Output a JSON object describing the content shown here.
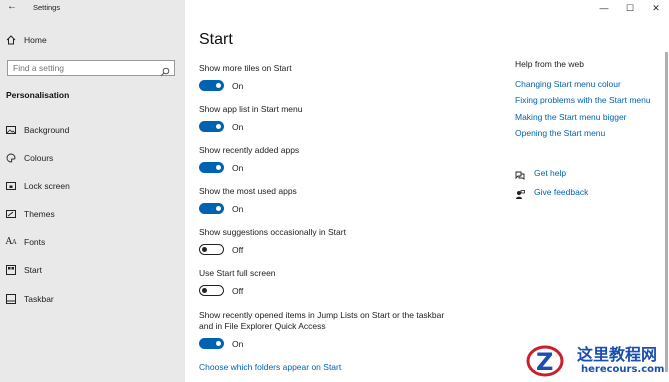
{
  "titlebar": {
    "back_glyph": "←",
    "title": "Settings",
    "minimize": "—",
    "maximize": "☐",
    "close": "✕"
  },
  "sidebar": {
    "home_label": "Home",
    "search_placeholder": "Find a setting",
    "section_title": "Personalisation",
    "items": [
      {
        "label": "Background",
        "icon": "picture-icon"
      },
      {
        "label": "Colours",
        "icon": "palette-icon"
      },
      {
        "label": "Lock screen",
        "icon": "lock-screen-icon"
      },
      {
        "label": "Themes",
        "icon": "brush-icon"
      },
      {
        "label": "Fonts",
        "icon": "font-icon"
      },
      {
        "label": "Start",
        "icon": "start-icon"
      },
      {
        "label": "Taskbar",
        "icon": "taskbar-icon"
      }
    ]
  },
  "main": {
    "title": "Start",
    "settings": [
      {
        "label": "Show more tiles on Start",
        "state": "On",
        "on": true
      },
      {
        "label": "Show app list in Start menu",
        "state": "On",
        "on": true
      },
      {
        "label": "Show recently added apps",
        "state": "On",
        "on": true
      },
      {
        "label": "Show the most used apps",
        "state": "On",
        "on": true
      },
      {
        "label": "Show suggestions occasionally in Start",
        "state": "Off",
        "on": false
      },
      {
        "label": "Use Start full screen",
        "state": "Off",
        "on": false
      },
      {
        "label": "Show recently opened items in Jump Lists on Start or the taskbar",
        "label2": "and in File Explorer Quick Access",
        "state": "On",
        "on": true
      }
    ],
    "folders_link": "Choose which folders appear on Start"
  },
  "help": {
    "title": "Help from the web",
    "links": [
      "Changing Start menu colour",
      "Fixing problems with the Start menu",
      "Making the Start menu bigger",
      "Opening the Start menu"
    ],
    "get_help": "Get help",
    "give_feedback": "Give feedback"
  },
  "watermark": {
    "line1": "这里教程网",
    "line2": "herecours.com"
  },
  "colors": {
    "accent": "#0063b1",
    "sidebar_bg": "#e9e9e9"
  }
}
